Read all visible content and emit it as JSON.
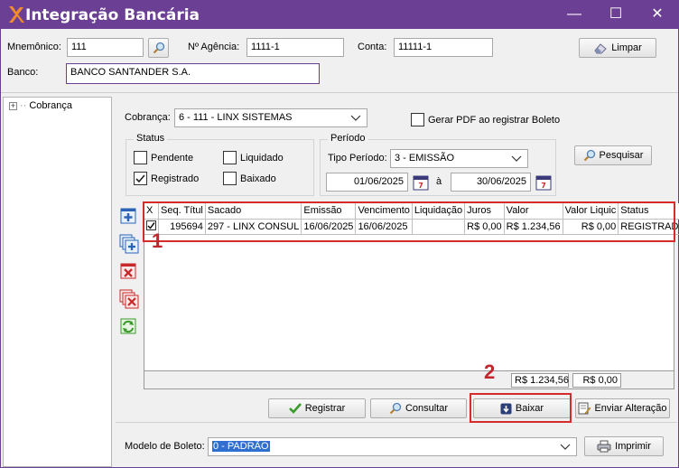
{
  "window": {
    "title": "Integração Bancária",
    "controls": {
      "minimize": "—",
      "maximize": "☐",
      "close": "✕"
    }
  },
  "header": {
    "mnemonico_label": "Mnemônico:",
    "mnemonico_value": "111",
    "agencia_label": "Nº Agência:",
    "agencia_value": "1111-1",
    "conta_label": "Conta:",
    "conta_value": "11111-1",
    "limpar_label": "Limpar",
    "banco_label": "Banco:",
    "banco_value": "BANCO SANTANDER S.A."
  },
  "tree": {
    "root_expander": "+",
    "root_label": "Cobrança"
  },
  "filters": {
    "cobranca_label": "Cobrança:",
    "cobranca_value": "6 - 111 - LINX SISTEMAS",
    "gerar_pdf_label": "Gerar PDF ao registrar Boleto",
    "gerar_pdf_checked": false,
    "status_group_title": "Status",
    "status": {
      "pendente": "Pendente",
      "liquidado": "Liquidado",
      "registrado": "Registrado",
      "baixado": "Baixado"
    },
    "periodo_group_title": "Período",
    "tipo_periodo_label": "Tipo Período:",
    "tipo_periodo_value": "3 - EMISSÃO",
    "data_inicio": "01/06/2025",
    "data_separator": "à",
    "data_fim": "30/06/2025",
    "pesquisar_label": "Pesquisar"
  },
  "grid": {
    "columns": [
      "X",
      "Seq. Títul",
      "Sacado",
      "Emissão",
      "Vencimento",
      "Liquidação",
      "Juros",
      "Valor",
      "Valor Liquic",
      "Status"
    ],
    "rows": [
      {
        "checked": true,
        "seq": "195694",
        "sacado": "297 - LINX CONSUL",
        "emissao": "16/06/2025",
        "vencimento": "16/06/2025",
        "liquidacao": "",
        "juros": "R$ 0,00",
        "valor": "R$ 1.234,56",
        "valor_liquido": "R$ 0,00",
        "status": "REGISTRAD"
      }
    ],
    "footer_total_valor": "R$ 1.234,56",
    "footer_total_liquido": "R$ 0,00"
  },
  "actions": {
    "registrar": "Registrar",
    "consultar": "Consultar",
    "baixar": "Baixar",
    "enviar_alteracao": "Enviar Alteração"
  },
  "bottom": {
    "modelo_label": "Modelo de Boleto:",
    "modelo_value": "0 - PADRÃO",
    "imprimir_label": "Imprimir"
  },
  "annotations": {
    "marker_1": "1",
    "marker_2": "2"
  },
  "colors": {
    "titlebar": "#6b3f93",
    "annotation_red": "#d42b2b",
    "check_green": "#3a9a2a",
    "icon_blue": "#2b63b8",
    "icon_red": "#c8282a"
  }
}
